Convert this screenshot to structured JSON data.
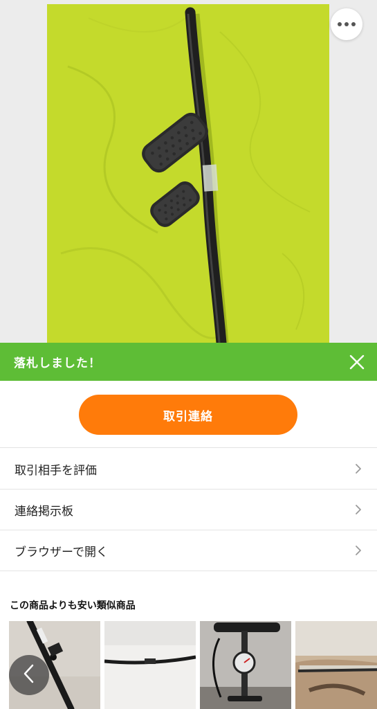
{
  "banner": {
    "text": "落札しました！",
    "color": "#5ebd36"
  },
  "primary_action": {
    "label": "取引連絡",
    "color": "#ff7b0a"
  },
  "menu": {
    "items": [
      {
        "label": "取引相手を評価",
        "icon": "chevron-right-icon"
      },
      {
        "label": "連絡掲示板",
        "icon": "chevron-right-icon"
      },
      {
        "label": "ブラウザーで開く",
        "icon": "chevron-right-icon"
      }
    ]
  },
  "similar": {
    "title": "この商品よりも安い類似商品"
  },
  "icons": {
    "more": "more-dots-icon",
    "close": "close-icon",
    "back": "chevron-left-icon"
  }
}
